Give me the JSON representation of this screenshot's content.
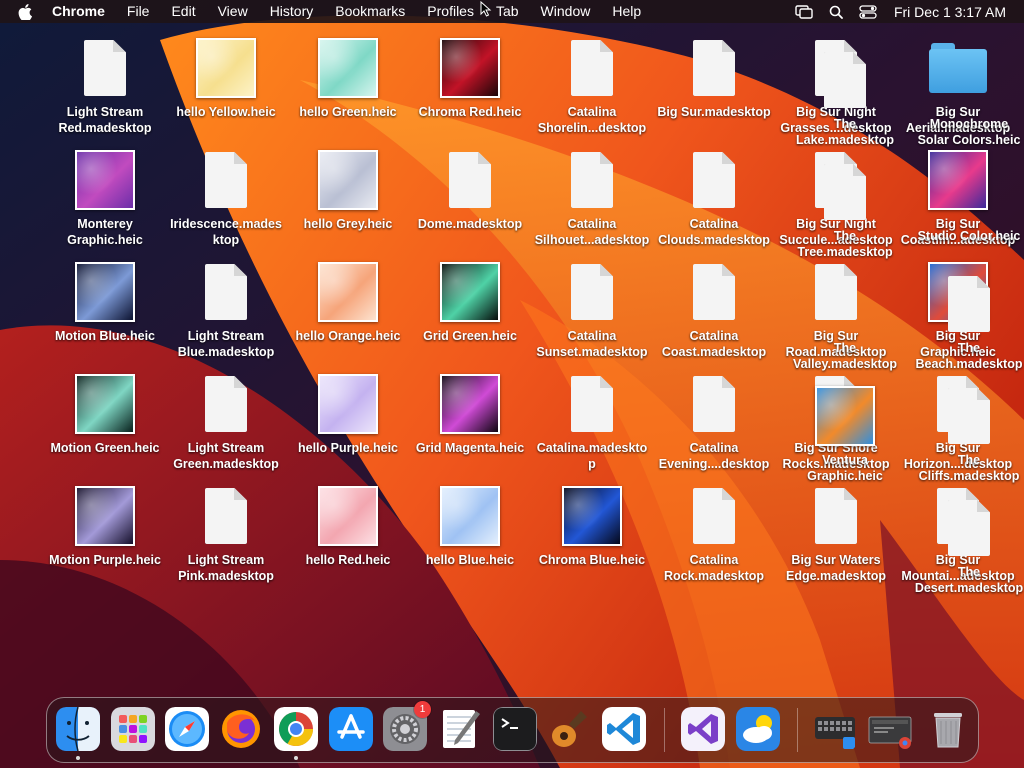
{
  "menubar": {
    "app_name": "Chrome",
    "items": [
      "File",
      "Edit",
      "View",
      "History",
      "Bookmarks",
      "Profiles",
      "Tab",
      "Window",
      "Help"
    ],
    "clock": "Fri Dec 1  3:17 AM"
  },
  "desktop": {
    "items": [
      {
        "label": "Light Stream\nRed.madesktop",
        "kind": "doc"
      },
      {
        "label": "hello Yellow.heic",
        "kind": "thumb",
        "colors": [
          "#fdf3c8",
          "#f6df8e"
        ]
      },
      {
        "label": "hello Green.heic",
        "kind": "thumb",
        "colors": [
          "#d7f5ee",
          "#7fd8c6"
        ]
      },
      {
        "label": "Chroma Red.heic",
        "kind": "thumb",
        "colors": [
          "#1a0608",
          "#c21327"
        ]
      },
      {
        "label": "Catalina\nShorelin...desktop",
        "kind": "doc"
      },
      {
        "label": "Big Sur.madesktop",
        "kind": "doc"
      },
      {
        "label": "Big Sur Night\nGrasses....desktop",
        "kind": "doc"
      },
      {
        "label": "Big Sur\nAerial.madesktop",
        "kind": "folder"
      },
      {
        "label": "Monterey\nGraphic.heic",
        "kind": "thumb",
        "colors": [
          "#6b2ea8",
          "#c14bbf"
        ]
      },
      {
        "label": "Iridescence.mades\nktop",
        "kind": "doc"
      },
      {
        "label": "hello Grey.heic",
        "kind": "thumb",
        "colors": [
          "#e9ebf2",
          "#b9bfd3"
        ]
      },
      {
        "label": "Dome.madesktop",
        "kind": "doc"
      },
      {
        "label": "Catalina\nSilhouet...adesktop",
        "kind": "doc"
      },
      {
        "label": "Catalina\nClouds.madesktop",
        "kind": "doc"
      },
      {
        "label": "Big Sur Night\nSuccule...adesktop",
        "kind": "doc"
      },
      {
        "label": "Big Sur\nCoastlin...adesktop",
        "kind": "thumb",
        "colors": [
          "#3b2a9a",
          "#e83a8c"
        ]
      },
      {
        "label": "Motion Blue.heic",
        "kind": "thumb",
        "colors": [
          "#0c1230",
          "#7d9ad6"
        ]
      },
      {
        "label": "Light Stream\nBlue.madesktop",
        "kind": "doc"
      },
      {
        "label": "hello Orange.heic",
        "kind": "thumb",
        "colors": [
          "#fde3d0",
          "#f6a47a"
        ]
      },
      {
        "label": "Grid Green.heic",
        "kind": "thumb",
        "colors": [
          "#050d0b",
          "#4fd2a6"
        ]
      },
      {
        "label": "Catalina\nSunset.madesktop",
        "kind": "doc"
      },
      {
        "label": "Catalina\nCoast.madesktop",
        "kind": "doc"
      },
      {
        "label": "Big Sur\nRoad.madesktop",
        "kind": "doc"
      },
      {
        "label": "Big Sur\nGraphic.heic",
        "kind": "thumb",
        "colors": [
          "#1c64d0",
          "#e04b3a"
        ]
      },
      {
        "label": "Motion Green.heic",
        "kind": "thumb",
        "colors": [
          "#08201c",
          "#7fd6c3"
        ]
      },
      {
        "label": "Light Stream\nGreen.madesktop",
        "kind": "doc"
      },
      {
        "label": "hello Purple.heic",
        "kind": "thumb",
        "colors": [
          "#ece5fb",
          "#c4b2f0"
        ]
      },
      {
        "label": "Grid Magenta.heic",
        "kind": "thumb",
        "colors": [
          "#0d0510",
          "#d04bd6"
        ]
      },
      {
        "label": "Catalina.madeskto\np",
        "kind": "doc"
      },
      {
        "label": "Catalina\nEvening....desktop",
        "kind": "doc"
      },
      {
        "label": "Big Sur Shore\nRocks.madesktop",
        "kind": "doc"
      },
      {
        "label": "Big Sur\nHorizon....desktop",
        "kind": "doc"
      },
      {
        "label": "Motion Purple.heic",
        "kind": "thumb",
        "colors": [
          "#150f2a",
          "#a39ad8"
        ]
      },
      {
        "label": "Light Stream\nPink.madesktop",
        "kind": "doc"
      },
      {
        "label": "hello Red.heic",
        "kind": "thumb",
        "colors": [
          "#fde0e4",
          "#f3a6b0"
        ]
      },
      {
        "label": "hello Blue.heic",
        "kind": "thumb",
        "colors": [
          "#e3effd",
          "#9fc2f3"
        ]
      },
      {
        "label": "Chroma Blue.heic",
        "kind": "thumb",
        "colors": [
          "#05081a",
          "#2257d6"
        ]
      },
      {
        "label": "Catalina\nRock.madesktop",
        "kind": "doc"
      },
      {
        "label": "Big Sur Waters\nEdge.madesktop",
        "kind": "doc"
      },
      {
        "label": "Big Sur\nMountai...adesktop",
        "kind": "doc"
      }
    ],
    "overlap_items": [
      {
        "label": "The\nLake.madesktop",
        "kind": "doc"
      },
      {
        "label": "Monochrome\nSolar Colors.heic",
        "kind": "none"
      },
      {
        "label": "The\nTree.madesktop",
        "kind": "doc"
      },
      {
        "label": "Studio Color.heic",
        "kind": "none"
      },
      {
        "label": "The\nValley.madesktop",
        "kind": "none"
      },
      {
        "label": "The\nBeach.madesktop",
        "kind": "doc"
      },
      {
        "label": "Ventura\nGraphic.heic",
        "kind": "thumb",
        "colors": [
          "#2f8fe0",
          "#f28a2a"
        ]
      },
      {
        "label": "The\nCliffs.madesktop",
        "kind": "doc"
      },
      {
        "label": "The\nDesert.madesktop",
        "kind": "doc"
      }
    ]
  },
  "dock": {
    "apps": [
      {
        "name": "finder-app",
        "icon": "finder-icon",
        "running": true
      },
      {
        "name": "launchpad-app",
        "icon": "launchpad-icon",
        "running": false
      },
      {
        "name": "safari-app",
        "icon": "safari-icon",
        "running": false
      },
      {
        "name": "firefox-app",
        "icon": "firefox-icon",
        "running": false
      },
      {
        "name": "chrome-app",
        "icon": "chrome-icon",
        "running": true
      },
      {
        "name": "app-store-app",
        "icon": "app-store-icon",
        "running": false
      },
      {
        "name": "system-settings-app",
        "icon": "settings-gear-icon",
        "running": false
      },
      {
        "name": "textedit-app",
        "icon": "notepad-pen-icon",
        "running": false
      },
      {
        "name": "terminal-app",
        "icon": "terminal-icon",
        "running": false
      },
      {
        "name": "garageband-app",
        "icon": "guitar-icon",
        "running": false
      },
      {
        "name": "vscode-app",
        "icon": "vscode-icon",
        "running": false
      },
      {
        "name": "visual-studio-app",
        "icon": "visual-studio-icon",
        "running": false
      },
      {
        "name": "weather-app",
        "icon": "weather-icon",
        "running": false
      },
      {
        "name": "keyboard-viewer-app",
        "icon": "keyboard-icon",
        "running": false
      },
      {
        "name": "recent-window-app",
        "icon": "window-thumbnail-icon",
        "running": false
      },
      {
        "name": "trash-app",
        "icon": "trash-icon",
        "running": false
      }
    ],
    "settings_badge": "1"
  }
}
